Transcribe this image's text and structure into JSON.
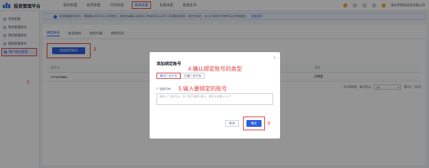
{
  "app": {
    "title": "投资管理平台"
  },
  "top_nav": [
    {
      "label": "投资管理"
    },
    {
      "label": "会员管理"
    },
    {
      "label": "冷饮派送"
    },
    {
      "label": "系统设置",
      "active": true
    },
    {
      "label": "全域派送"
    },
    {
      "label": "投放证书"
    }
  ],
  "top_right": {
    "user": "泰州市明岛投资有限公司"
  },
  "sidebar": [
    {
      "label": "系统配置"
    },
    {
      "label": "我的配置账号"
    },
    {
      "label": "我的配置账号"
    },
    {
      "label": "模板配置账号"
    },
    {
      "label": "账户账号管理",
      "active": true
    }
  ],
  "notice": {
    "text": "若您需要绑定账号，需要确认账号可以正常使用，绑定前请确认该账号已完成资质认证并已开通投放权限，绑定完成后，若与已有账号冲突将无法完成绑定。",
    "link": "查看说明"
  },
  "tabs": [
    {
      "label": "绑定账号",
      "active": true
    },
    {
      "label": "账号授权"
    },
    {
      "label": "授权列表"
    },
    {
      "label": "授权历史"
    }
  ],
  "add_button": "添加绑定账号",
  "table": {
    "headers": [
      "账号ID",
      "状态"
    ],
    "rows": [
      [
        "1771676654",
        "已绑定"
      ]
    ]
  },
  "pager": {
    "total": "共1条数据",
    "per_page_label": "每页显示",
    "per_page": "10",
    "page_info": "第1页，共1页"
  },
  "modal": {
    "title": "添加绑定账号",
    "close": "×",
    "type_tabs": [
      "腾讯广告平台",
      "巨量广告平台"
    ],
    "field_label": "广告账号ID",
    "placeholder": "请输入广告账号ID，多个账号请换行输入，最多支持输入100个",
    "cancel": "取消",
    "confirm": "确定"
  },
  "annotations": {
    "n2": "2",
    "n3": "3",
    "n4": "4 确认绑定账号的类型",
    "n5": "5 输入要绑定的账号",
    "n6": "6"
  },
  "colors": {
    "primary": "#2b5fe0",
    "annotation": "#e53935"
  }
}
